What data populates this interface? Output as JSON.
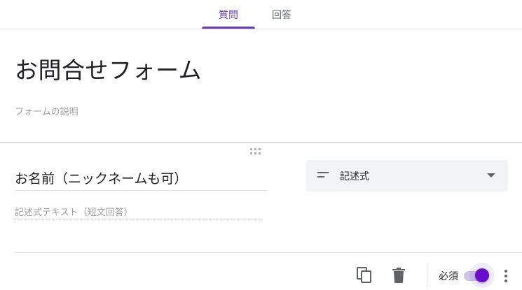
{
  "tabs": {
    "questions": "質問",
    "responses": "回答"
  },
  "form": {
    "title": "お問合せフォーム",
    "description_placeholder": "フォームの説明"
  },
  "question": {
    "title": "お名前（ニックネームも可）",
    "type_icon": "short-answer-icon",
    "type_label": "記述式",
    "answer_placeholder": "記述式テキスト（短文回答）"
  },
  "footer": {
    "copy_icon": "copy-icon",
    "delete_icon": "trash-icon",
    "required_label": "必須",
    "required": true,
    "more_icon": "more-vert-icon"
  },
  "colors": {
    "accent": "#673ab7",
    "toggle_thumb": "#6a0dcd",
    "toggle_track": "#d1c4e9",
    "select_bg": "#f1f3f4"
  }
}
